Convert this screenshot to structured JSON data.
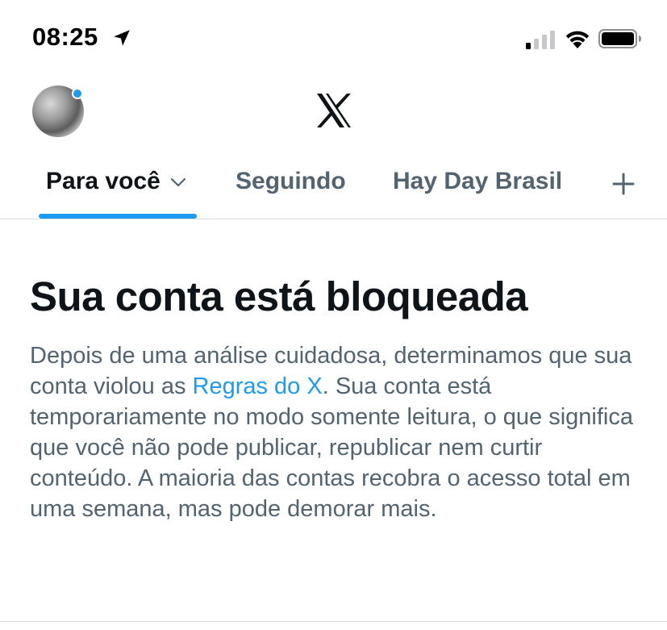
{
  "status_bar": {
    "time": "08:25"
  },
  "header": {
    "logo": "x-logo-icon"
  },
  "tabs": [
    {
      "label": "Para você",
      "active": true,
      "has_dropdown": true
    },
    {
      "label": "Seguindo",
      "active": false
    },
    {
      "label": "Hay Day Brasil",
      "active": false
    }
  ],
  "notice": {
    "title": "Sua conta está bloqueada",
    "body_before_link": "Depois de uma análise cuidadosa, determinamos que sua conta violou as ",
    "link_text": "Regras do X",
    "body_after_link": ". Sua conta está temporariamente no modo somente leitura, o que significa que você não pode publicar, republicar nem curtir conteúdo. A maioria das contas recobra o acesso total em uma semana, mas pode demorar mais."
  },
  "colors": {
    "accent": "#1d9bf0",
    "text_primary": "#0f1419",
    "text_secondary": "#536471",
    "divider": "#d9dde0"
  }
}
